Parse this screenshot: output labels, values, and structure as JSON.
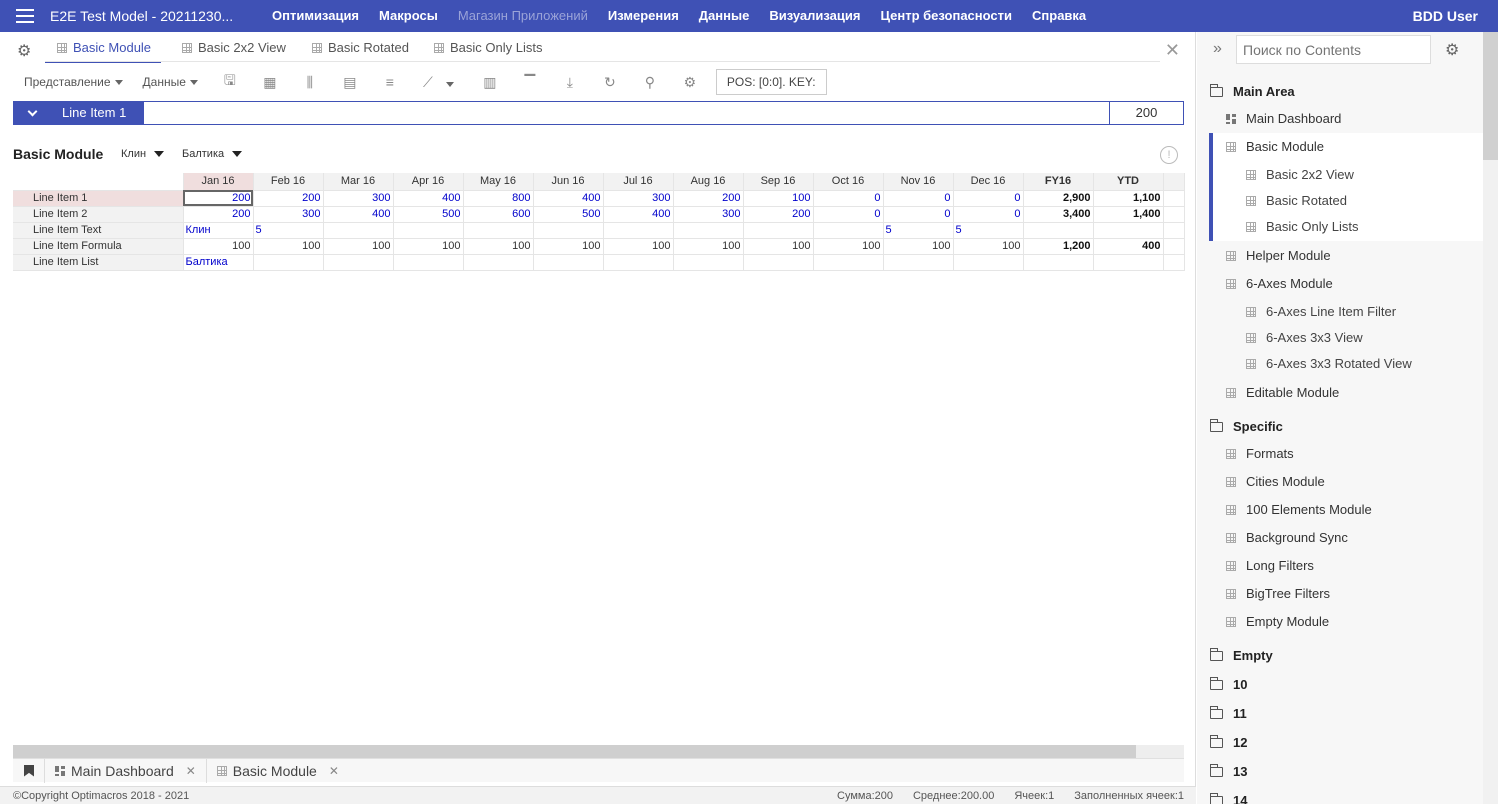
{
  "topbar": {
    "app_title": "E2E Test Model - 20211230...",
    "menu": [
      {
        "label": "Оптимизация",
        "dim": false
      },
      {
        "label": "Макросы",
        "dim": false
      },
      {
        "label": "Магазин Приложений",
        "dim": true
      },
      {
        "label": "Измерения",
        "dim": false
      },
      {
        "label": "Данные",
        "dim": false
      },
      {
        "label": "Визуализация",
        "dim": false
      },
      {
        "label": "Центр безопасности",
        "dim": false
      },
      {
        "label": "Справка",
        "dim": false
      }
    ],
    "user": "BDD User"
  },
  "tabs": [
    "Basic Module",
    "Basic 2x2 View",
    "Basic Rotated",
    "Basic Only Lists"
  ],
  "toolbar": {
    "view_label": "Представление",
    "data_label": "Данные",
    "pos_key": "POS: [0:0]. KEY:"
  },
  "line_item_bar": {
    "name": "Line Item 1",
    "value": "200"
  },
  "module": {
    "title": "Basic Module",
    "filter1": "Клин",
    "filter2": "Балтика",
    "info_icon": "!"
  },
  "grid": {
    "columns": [
      "Jan 16",
      "Feb 16",
      "Mar 16",
      "Apr 16",
      "May 16",
      "Jun 16",
      "Jul 16",
      "Aug 16",
      "Sep 16",
      "Oct 16",
      "Nov 16",
      "Dec 16",
      "FY16",
      "YTD"
    ],
    "rows": [
      {
        "label": "Line Item 1",
        "cells": [
          "200",
          "200",
          "300",
          "400",
          "800",
          "400",
          "300",
          "200",
          "100",
          "0",
          "0",
          "0",
          "2,900",
          "1,100"
        ]
      },
      {
        "label": "Line Item 2",
        "cells": [
          "200",
          "300",
          "400",
          "500",
          "600",
          "500",
          "400",
          "300",
          "200",
          "0",
          "0",
          "0",
          "3,400",
          "1,400"
        ]
      },
      {
        "label": "Line Item Text",
        "cells": [
          "Клин",
          "5",
          "",
          "",
          "",
          "",
          "",
          "",
          "",
          "",
          "5",
          "5",
          "",
          ""
        ]
      },
      {
        "label": "Line Item Formula",
        "cells": [
          "100",
          "100",
          "100",
          "100",
          "100",
          "100",
          "100",
          "100",
          "100",
          "100",
          "100",
          "100",
          "1,200",
          "400"
        ]
      },
      {
        "label": "Line Item List",
        "cells": [
          "Балтика",
          "",
          "",
          "",
          "",
          "",
          "",
          "",
          "",
          "",
          "",
          "",
          "",
          ""
        ]
      }
    ]
  },
  "bottom_tabs": [
    "Main Dashboard",
    "Basic Module"
  ],
  "status": {
    "copyright": "©Copyright Optimacros 2018 - 2021",
    "sum": "Сумма:200",
    "avg": "Среднее:200.00",
    "cells": "Ячеек:1",
    "filled": "Заполненных ячеек:1"
  },
  "sidebar": {
    "search_placeholder": "Поиск по Contents",
    "groups": [
      {
        "label": "Main Area",
        "items": [
          {
            "label": "Main Dashboard",
            "level": 1,
            "icon": "dashboard-icon"
          },
          {
            "label": "Basic Module",
            "level": 1,
            "icon": "grid-icon"
          },
          {
            "label": "Basic 2x2 View",
            "level": 2,
            "icon": "grid-icon"
          },
          {
            "label": "Basic Rotated",
            "level": 2,
            "icon": "grid-icon"
          },
          {
            "label": "Basic Only Lists",
            "level": 2,
            "icon": "grid-icon"
          },
          {
            "label": "Helper Module",
            "level": 1,
            "icon": "grid-icon"
          },
          {
            "label": "6-Axes Module",
            "level": 1,
            "icon": "grid-icon"
          },
          {
            "label": "6-Axes Line Item Filter",
            "level": 2,
            "icon": "grid-icon"
          },
          {
            "label": "6-Axes 3x3 View",
            "level": 2,
            "icon": "grid-icon"
          },
          {
            "label": "6-Axes 3x3 Rotated View",
            "level": 2,
            "icon": "grid-icon"
          },
          {
            "label": "Editable Module",
            "level": 1,
            "icon": "grid-icon"
          }
        ]
      },
      {
        "label": "Specific",
        "items": [
          {
            "label": "Formats",
            "level": 1,
            "icon": "grid-icon"
          },
          {
            "label": "Cities Module",
            "level": 1,
            "icon": "grid-icon"
          },
          {
            "label": "100 Elements Module",
            "level": 1,
            "icon": "grid-icon"
          },
          {
            "label": "Background Sync",
            "level": 1,
            "icon": "grid-icon"
          },
          {
            "label": "Long Filters",
            "level": 1,
            "icon": "grid-icon"
          },
          {
            "label": "BigTree Filters",
            "level": 1,
            "icon": "grid-icon"
          },
          {
            "label": "Empty Module",
            "level": 1,
            "icon": "grid-icon"
          }
        ]
      },
      {
        "label": "Empty",
        "items": []
      },
      {
        "label": "10",
        "items": []
      },
      {
        "label": "11",
        "items": []
      },
      {
        "label": "12",
        "items": []
      },
      {
        "label": "13",
        "items": []
      },
      {
        "label": "14",
        "items": []
      }
    ]
  },
  "colors": {
    "accent": "#3f51b5",
    "input_blue": "#0000cc"
  }
}
